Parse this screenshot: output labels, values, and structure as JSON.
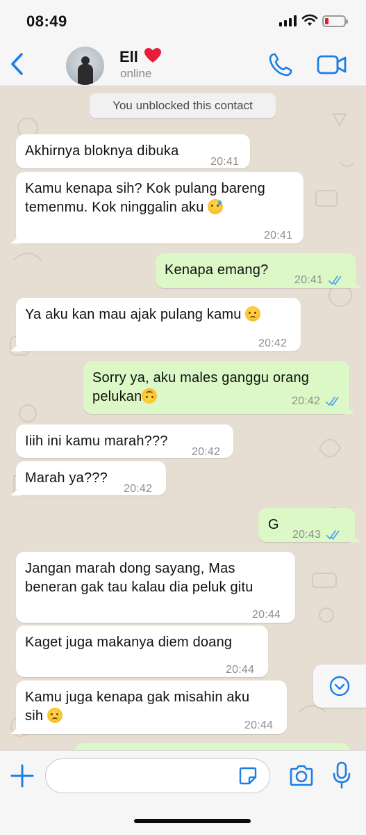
{
  "status_bar": {
    "time": "08:49",
    "battery_color": "#e0202a"
  },
  "header": {
    "contact_name": "Ell",
    "heart": "❤️",
    "status": "online",
    "accent": "#1a7ee6",
    "icons": [
      "chevron-left-icon",
      "phone-icon",
      "video-camera-icon"
    ]
  },
  "system_message": "You unblocked this contact",
  "messages": [
    {
      "dir": "in",
      "text": "Akhirnya bloknya dibuka",
      "time": "20:41"
    },
    {
      "dir": "in",
      "lines": [
        "Kamu kenapa sih? Kok pulang bareng",
        "temenmu. Kok ninggalin aku"
      ],
      "emoji": "downcast-sweat-emoji",
      "time": "20:41"
    },
    {
      "dir": "out",
      "text": "Kenapa emang?",
      "time": "20:41",
      "read": true
    },
    {
      "dir": "in",
      "text": "Ya aku kan mau ajak pulang kamu",
      "emoji": "disappointed-emoji",
      "time": "20:42"
    },
    {
      "dir": "out",
      "lines": [
        "Sorry ya, aku males ganggu orang",
        "pelukan"
      ],
      "emoji": "upside-down-emoji",
      "time": "20:42",
      "read": true
    },
    {
      "dir": "in",
      "text": "Iiih ini kamu marah???",
      "time": "20:42"
    },
    {
      "dir": "in",
      "text": "Marah ya???",
      "time": "20:42"
    },
    {
      "dir": "out",
      "text": "G",
      "time": "20:43",
      "read": true
    },
    {
      "dir": "in",
      "lines": [
        "Jangan marah dong sayang, Mas",
        "beneran gak tau kalau dia peluk gitu"
      ],
      "time": "20:44"
    },
    {
      "dir": "in",
      "text": "Kaget juga makanya diem doang",
      "time": "20:44"
    },
    {
      "dir": "in",
      "lines": [
        "Kamu juga kenapa gak misahin aku",
        "sih"
      ],
      "emoji": "disappointed-emoji",
      "time": "20:44"
    }
  ],
  "colors": {
    "incoming": "#ffffff",
    "outgoing": "#dcf8c6",
    "wallpaper": "#e6ddd3",
    "read_tick": "#4fa6ec"
  },
  "input_bar": {
    "placeholder": "",
    "icons": [
      "plus-icon",
      "sticker-icon",
      "camera-icon",
      "microphone-icon"
    ]
  }
}
